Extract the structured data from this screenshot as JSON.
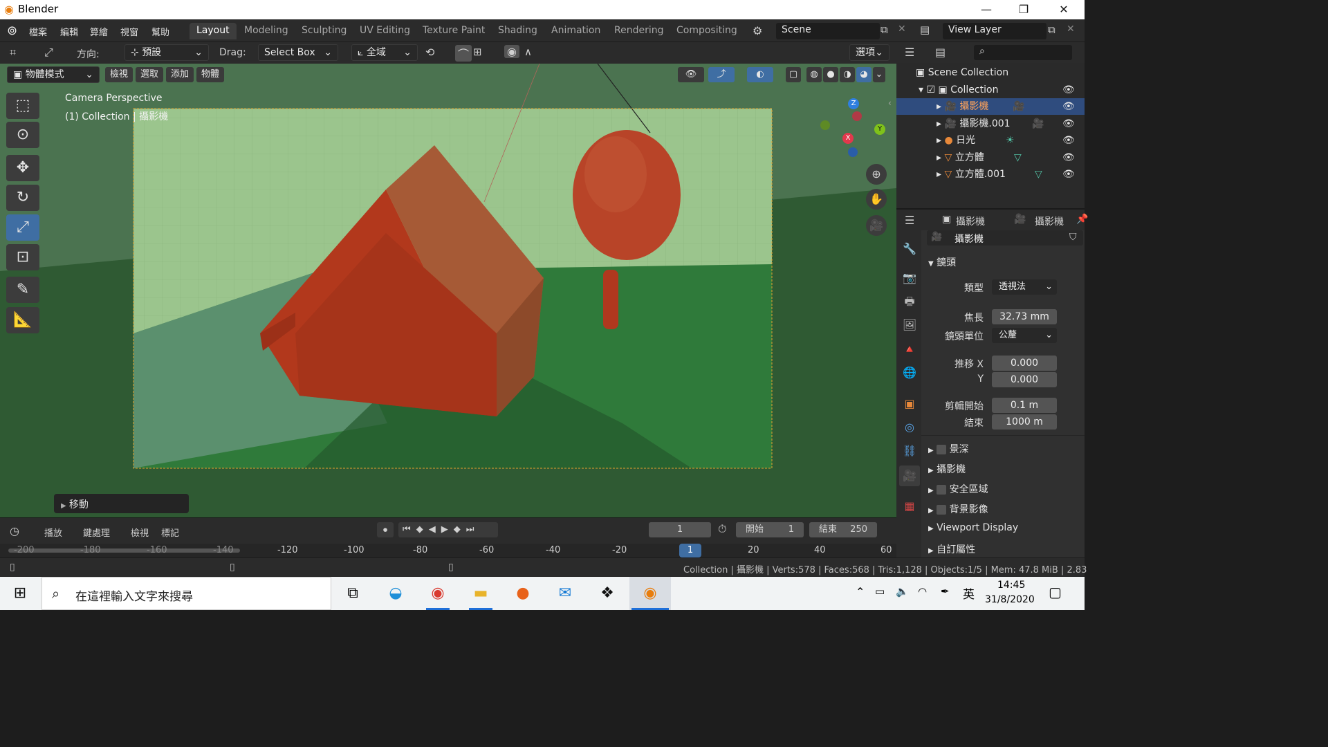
{
  "window": {
    "title": "Blender"
  },
  "menus": [
    "檔案",
    "編輯",
    "算繪",
    "視窗",
    "幫助"
  ],
  "workspaces": [
    "Layout",
    "Modeling",
    "Sculpting",
    "UV Editing",
    "Texture Paint",
    "Shading",
    "Animation",
    "Rendering",
    "Compositing"
  ],
  "scene": {
    "label": "Scene"
  },
  "view_layer": {
    "label": "View Layer"
  },
  "tool_header": {
    "orientation_label": "方向:",
    "orientation_value": "預設",
    "drag_label": "Drag:",
    "drag_value": "Select Box",
    "transform_value": "全域",
    "options_label": "選項"
  },
  "viewport_header": {
    "mode": "物體模式",
    "items": [
      "檢視",
      "選取",
      "添加",
      "物體"
    ]
  },
  "viewport": {
    "info_line1": "Camera Perspective",
    "info_line2": "(1) Collection | 攝影機",
    "last_op": "移動",
    "gizmo": {
      "z": "Z",
      "y": "Y",
      "x": "X"
    }
  },
  "outliner": {
    "scene_collection": "Scene Collection",
    "collection": "Collection",
    "items": [
      {
        "name": "攝影機",
        "selected": true
      },
      {
        "name": "攝影機.001",
        "selected": false
      },
      {
        "name": "日光",
        "selected": false
      },
      {
        "name": "立方體",
        "selected": false
      },
      {
        "name": "立方體.001",
        "selected": false
      }
    ]
  },
  "properties": {
    "breadcrumb_obj": "攝影機",
    "breadcrumb_data": "攝影機",
    "data_name": "攝影機",
    "lens_section": "鏡頭",
    "type_label": "類型",
    "type_value": "透視法",
    "focal_label": "焦長",
    "focal_value": "32.73 mm",
    "lens_unit_label": "鏡頭單位",
    "lens_unit_value": "公釐",
    "shift_x_label": "推移 X",
    "shift_x_value": "0.000",
    "shift_y_label": "Y",
    "shift_y_value": "0.000",
    "clip_start_label": "剪輯開始",
    "clip_start_value": "0.1 m",
    "clip_end_label": "結束",
    "clip_end_value": "1000 m",
    "sections": [
      "景深",
      "攝影機",
      "安全區域",
      "背景影像",
      "Viewport Display",
      "自訂屬性"
    ]
  },
  "timeline": {
    "menus": [
      "播放",
      "鍵處理",
      "檢視",
      "標記"
    ],
    "current_frame": "1",
    "start_label": "開始",
    "start_value": "1",
    "end_label": "結束",
    "end_value": "250",
    "ruler": [
      "-200",
      "-180",
      "-160",
      "-140",
      "-120",
      "-100",
      "-80",
      "-60",
      "-40",
      "-20",
      "1",
      "20",
      "40",
      "60"
    ]
  },
  "status": {
    "text": "Collection | 攝影機 | Verts:578 | Faces:568 | Tris:1,128 | Objects:1/5 | Mem: 47.8 MiB | 2.83"
  },
  "taskbar": {
    "search_placeholder": "在這裡輸入文字來搜尋",
    "ime": "英",
    "time": "14:45",
    "date": "31/8/2020"
  },
  "colors": {
    "accent": "#3f6ea3",
    "selected_row": "#2f4c7e",
    "camera_frame": "#e6a32c"
  }
}
